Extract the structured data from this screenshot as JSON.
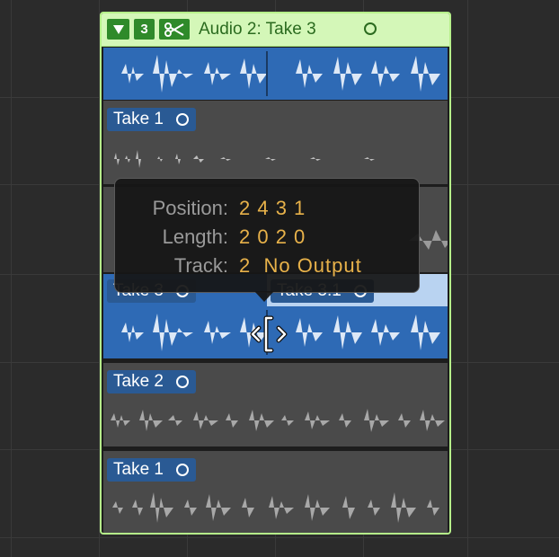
{
  "folder": {
    "collapse_icon": "disclosure-triangle-icon",
    "take_count": "3",
    "scissors_icon": "scissors-icon",
    "title": "Audio 2: Take 3",
    "accent_color": "#b6f08a"
  },
  "lanes": [
    {
      "label": "Take 1",
      "style": "grey"
    },
    {
      "label": "Take 3",
      "style": "blue"
    },
    {
      "label": "Take 3.1",
      "style": "blue"
    },
    {
      "label": "Take 2",
      "style": "grey"
    },
    {
      "label": "Take 1",
      "style": "grey"
    }
  ],
  "tooltip": {
    "position_label": "Position:",
    "position_value": "2 4 3 1",
    "length_label": "Length:",
    "length_value": "2 0 2 0",
    "track_label": "Track:",
    "track_value": "2  No Output"
  },
  "cursor": {
    "icon": "resize-cursor-icon"
  },
  "colors": {
    "region_blue": "#2e6ab5",
    "region_grey": "#4a4a4a",
    "value_text": "#e8b24a"
  }
}
